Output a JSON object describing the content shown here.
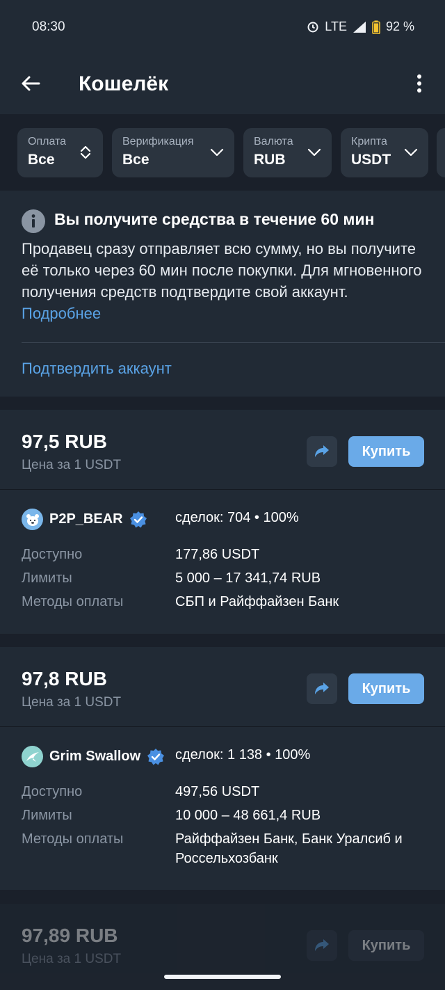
{
  "status": {
    "time": "08:30",
    "network": "LTE",
    "battery": "92 %"
  },
  "appbar": {
    "title": "Кошелёк"
  },
  "filters": [
    {
      "caption": "Оплата",
      "value": "Все"
    },
    {
      "caption": "Верификация",
      "value": "Все"
    },
    {
      "caption": "Валюта",
      "value": "RUB"
    },
    {
      "caption": "Крипта",
      "value": "USDT"
    }
  ],
  "notice": {
    "title": "Вы получите средства в течение 60 мин",
    "body": "Продавец сразу отправляет всю сумму, но вы получите её только через 60 мин после покупки. Для мгновенного получения средств подтвердите свой аккаунт.",
    "more_link": "Подробнее",
    "verify_link": "Подтвердить аккаунт"
  },
  "labels": {
    "price_caption": "Цена за 1 USDT",
    "buy": "Купить",
    "available": "Доступно",
    "limits": "Лимиты",
    "methods": "Методы оплаты"
  },
  "offers": [
    {
      "price": "97,5 RUB",
      "seller": "P2P_BEAR",
      "deals": "сделок: 704 • 100%",
      "available": "177,86 USDT",
      "limits": "5 000 – 17 341,74 RUB",
      "methods": "СБП и Райффайзен Банк"
    },
    {
      "price": "97,8 RUB",
      "seller": "Grim Swallow",
      "deals": "сделок: 1 138 • 100%",
      "available": "497,56 USDT",
      "limits": "10 000 – 48 661,4 RUB",
      "methods": "Райффайзен Банк, Банк Уралсиб и Россельхозбанк"
    },
    {
      "price": "97,89 RUB"
    }
  ],
  "colors": {
    "background": "#1a202a",
    "surface": "#212a35",
    "accent": "#5aa3e6",
    "buy_button": "#6aaae8",
    "verified_badge": "#4a90e2"
  }
}
